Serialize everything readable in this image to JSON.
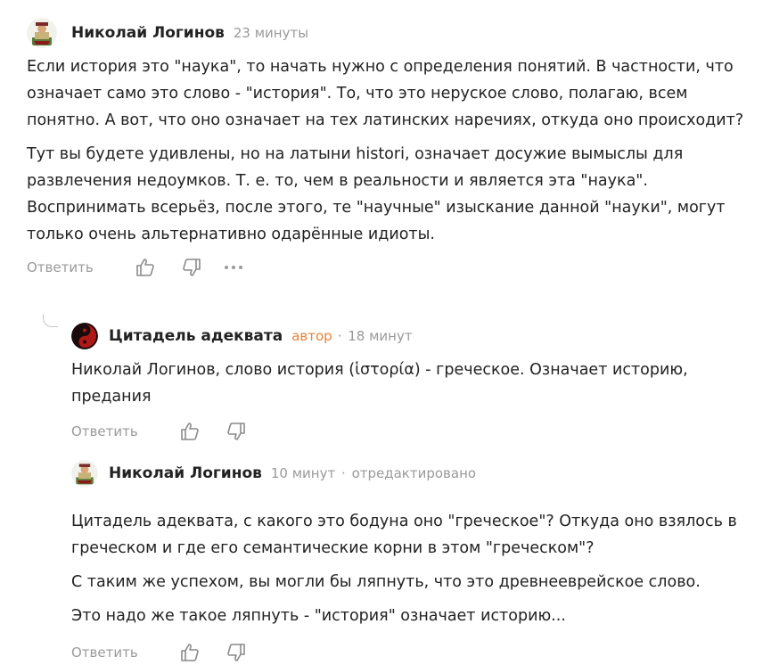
{
  "comments": [
    {
      "author": "Николай Логинов",
      "time": "23 минуты",
      "paragraphs": [
        "Если история это \"наука\", то начать нужно с определения понятий. В частности, что означает само это слово - \"история\". То, что это неруское слово, полагаю, всем понятно. А вот, что оно означает на тех латинских наречиях, откуда оно происходит?",
        "Тут вы будете удивлены, но на латыни histori, означает досужие вымыслы для развлечения недоумков. Т. е. то, чем в реальности и является эта \"наука\". Воспринимать всерьёз, после этого, те \"научные\" изыскание данной \"науки\", могут только очень альтернативно одарённые идиоты."
      ],
      "reply_label": "Ответить"
    },
    {
      "author": "Цитадель адеквата",
      "role": "автор",
      "separator": "·",
      "time": "18 минут",
      "paragraphs": [
        "Николай Логинов, слово история (ἱστορία) - греческое. Означает историю, предания"
      ],
      "reply_label": "Ответить"
    },
    {
      "author": "Николай Логинов",
      "time": "10 минут",
      "separator": "·",
      "edited": "отредактировано",
      "paragraphs": [
        "Цитадель адеквата, с какого это бодуна оно \"греческое\"? Откуда оно взялось в греческом и где его семантические корни в этом \"греческом\"?",
        "С таким же успехом, вы могли бы ляпнуть, что это древнееврейское слово.",
        "Это надо же такое ляпнуть - \"история\" означает историю..."
      ],
      "reply_label": "Ответить"
    }
  ],
  "icons": {
    "like": "thumb-up-icon",
    "dislike": "thumb-down-icon",
    "more": "more-dots-icon"
  },
  "colors": {
    "author_role": "#e8833a",
    "meta": "#9a9a9a",
    "text": "#222222",
    "icon": "#8a8a8a"
  }
}
